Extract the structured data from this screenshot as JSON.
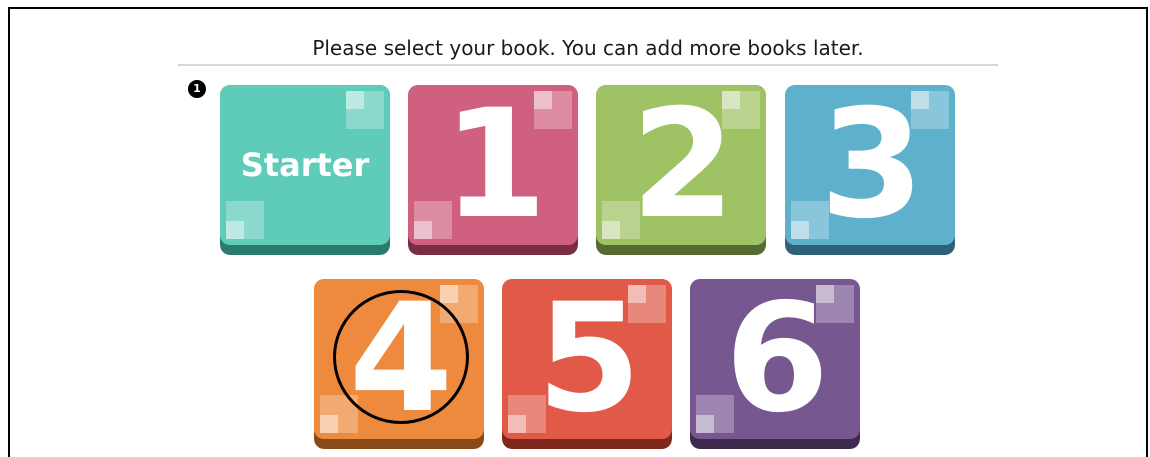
{
  "instruction": "Please select your book. You can add more books later.",
  "step_badge": "1",
  "books": [
    {
      "label": "Starter",
      "color": "#5fcbb9",
      "shade": "#2a7a6e"
    },
    {
      "label": "1",
      "color": "#d0607f",
      "shade": "#7a2e44"
    },
    {
      "label": "2",
      "color": "#9fc265",
      "shade": "#566b32"
    },
    {
      "label": "3",
      "color": "#5eb0cd",
      "shade": "#2c6178"
    },
    {
      "label": "4",
      "color": "#ee8a3e",
      "shade": "#8a4a18"
    },
    {
      "label": "5",
      "color": "#e05a47",
      "shade": "#80281d"
    },
    {
      "label": "6",
      "color": "#77578f",
      "shade": "#3d2a4c"
    }
  ]
}
